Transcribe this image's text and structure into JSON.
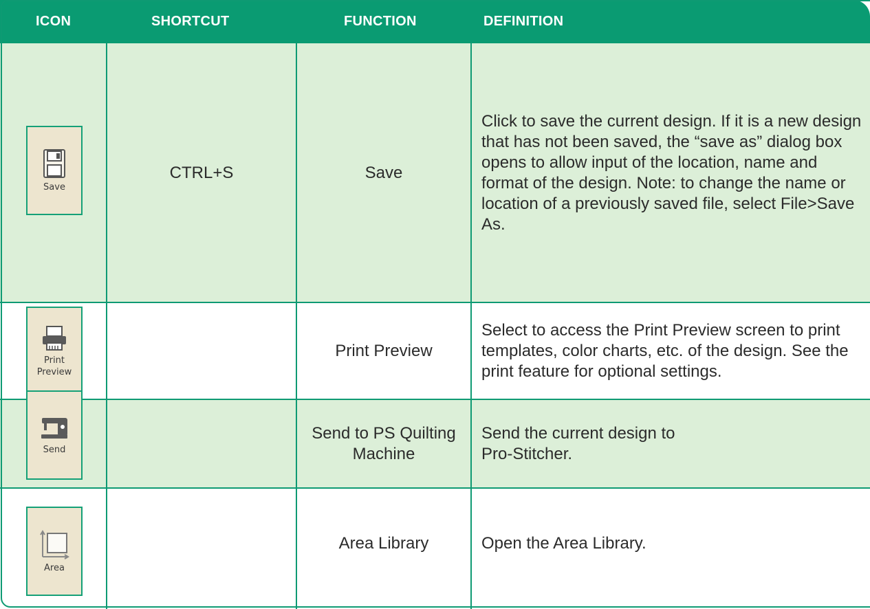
{
  "header": {
    "icon": "ICON",
    "shortcut": "SHORTCUT",
    "function": "FUNCTION",
    "definition": "DEFINITION"
  },
  "rows": [
    {
      "icon_name": "floppy-disk-icon",
      "icon_label": "Save",
      "shortcut": "CTRL+S",
      "function": "Save",
      "definition": "Click to save the current design. If it is a new design that has not been saved, the “save as” dialog box opens to allow input of the location, name and format of the design. Note: to change the name or location of a previously saved file, select File>Save As."
    },
    {
      "icon_name": "printer-icon",
      "icon_label": "Print Preview",
      "shortcut": "",
      "function": "Print Preview",
      "definition": "Select to access the Print Preview screen to print templates, color charts, etc. of the design. See the print feature for optional settings."
    },
    {
      "icon_name": "sewing-machine-icon",
      "icon_label": "Send",
      "shortcut": "",
      "function": "Send to PS Quilting Machine",
      "definition": "Send the current design to Pro-Stitcher."
    },
    {
      "icon_name": "area-square-icon",
      "icon_label": "Area",
      "shortcut": "",
      "function": "Area Library",
      "definition": "Open the Area Library."
    }
  ],
  "colors": {
    "header_bg": "#0a9b72",
    "row_green": "#dcefd8",
    "border": "#0e9a73",
    "icon_bg": "#ede5cf"
  }
}
